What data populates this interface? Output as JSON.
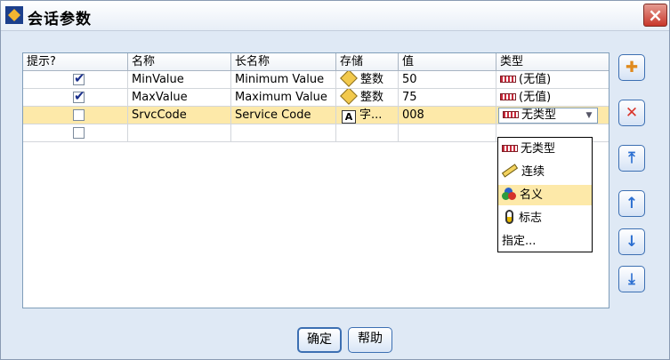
{
  "window": {
    "title": "会话参数",
    "close_label": "×"
  },
  "grid": {
    "columns": [
      "提示?",
      "名称",
      "长名称",
      "存储",
      "值",
      "类型"
    ],
    "rows": [
      {
        "prompt_checked": true,
        "name": "MinValue",
        "long_name": "Minimum Value",
        "storage_icon": "diamond-icon",
        "storage": "整数",
        "value": "50",
        "type": "(无值)"
      },
      {
        "prompt_checked": true,
        "name": "MaxValue",
        "long_name": "Maximum Value",
        "storage_icon": "diamond-icon",
        "storage": "整数",
        "value": "75",
        "type": "(无值)"
      },
      {
        "prompt_checked": false,
        "name": "SrvcCode",
        "long_name": "Service Code",
        "storage_icon": "string-icon",
        "storage": "字...",
        "value": "008",
        "type": "无类型",
        "selected": true
      },
      {
        "prompt_checked": false,
        "name": "",
        "long_name": "",
        "storage": "",
        "value": "",
        "type": ""
      }
    ]
  },
  "icons": {
    "checkmark": "✔",
    "string_letter": "A"
  },
  "type_dropdown": {
    "options": [
      {
        "label": "无类型",
        "icon": "flag-icon"
      },
      {
        "label": "连续",
        "icon": "ruler-icon"
      },
      {
        "label": "名义",
        "icon": "nominal-icon",
        "highlighted": true
      },
      {
        "label": "标志",
        "icon": "bulb-icon"
      },
      {
        "label": "指定...",
        "icon": ""
      }
    ]
  },
  "side_buttons": [
    "add-parameter",
    "delete",
    "move-top",
    "move-up",
    "move-down",
    "move-bottom"
  ],
  "side_glyphs": {
    "add": "✚",
    "delete": "✕",
    "top": "⤒",
    "up": "↑",
    "down": "↓",
    "bottom": "⤓"
  },
  "buttons": {
    "ok": "确定",
    "help": "帮助"
  }
}
